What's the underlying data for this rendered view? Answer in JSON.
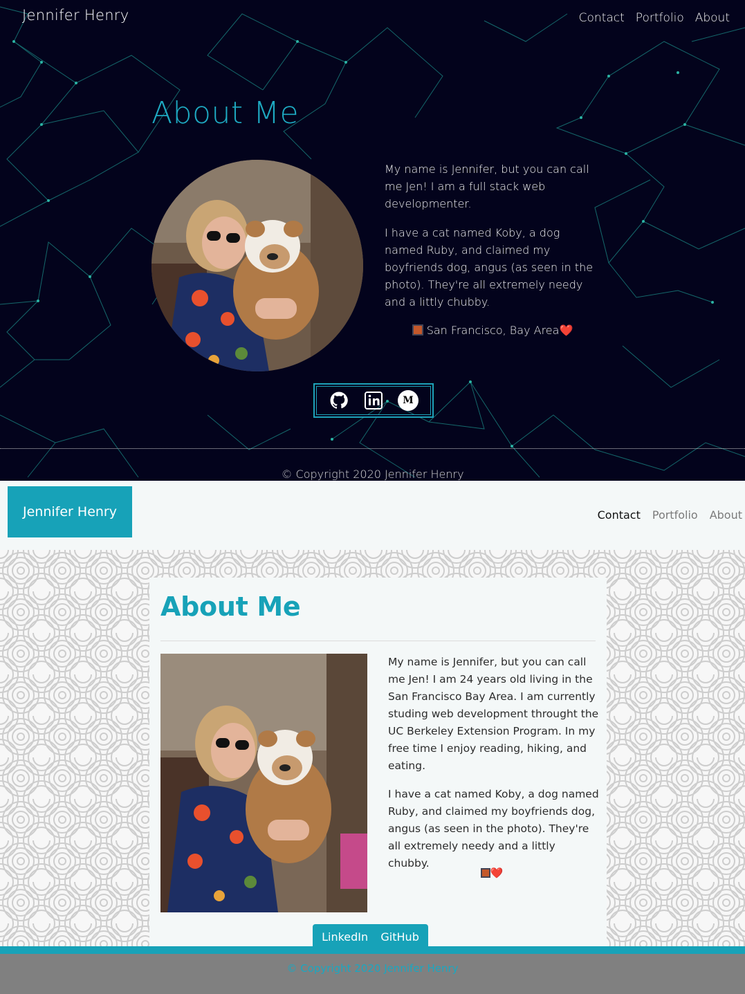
{
  "dark_version": {
    "brand": "Jennifer Henry",
    "nav": [
      "Contact",
      "Portfolio",
      "About"
    ],
    "title": "About Me",
    "bio": [
      "My name is Jennifer, but you can call me Jen! I am a full stack web developmenter.",
      "I have a cat named Koby, a dog named Ruby, and claimed my boyfriends dog, angus (as seen in the photo). They're all extremely needy and a littly chubby."
    ],
    "location": "San Francisco, Bay Area",
    "location_emoji_end": "❤️",
    "social_icons": [
      "github-icon",
      "linkedin-icon",
      "medium-icon"
    ],
    "medium_letter": "M",
    "copyright": "© Copyright 2020 Jennifer Henry",
    "colors": {
      "background": "#03031c",
      "accent": "#1eaac2"
    }
  },
  "light_version": {
    "brand": "Jennifer Henry",
    "nav": [
      "Contact",
      "Portfolio",
      "About"
    ],
    "active_nav": "Contact",
    "title": "About Me",
    "bio": [
      "My name is Jennifer, but you can call me Jen! I am 24 years old living in the San Francisco Bay Area. I am currently studing web development throught the UC Berkeley Extension Program. In my free time I enjoy reading, hiking, and eating.",
      "I have a cat named Koby, a dog named Ruby, and claimed my boyfriends dog, angus (as seen in the photo). They're all extremely needy and a littly chubby."
    ],
    "emoji_line": "❤️",
    "buttons": [
      "LinkedIn",
      "GitHub"
    ],
    "copyright": "© Copyright 2020 Jennifer Henry",
    "colors": {
      "accent": "#17a2b8",
      "footer": "#808080"
    }
  }
}
